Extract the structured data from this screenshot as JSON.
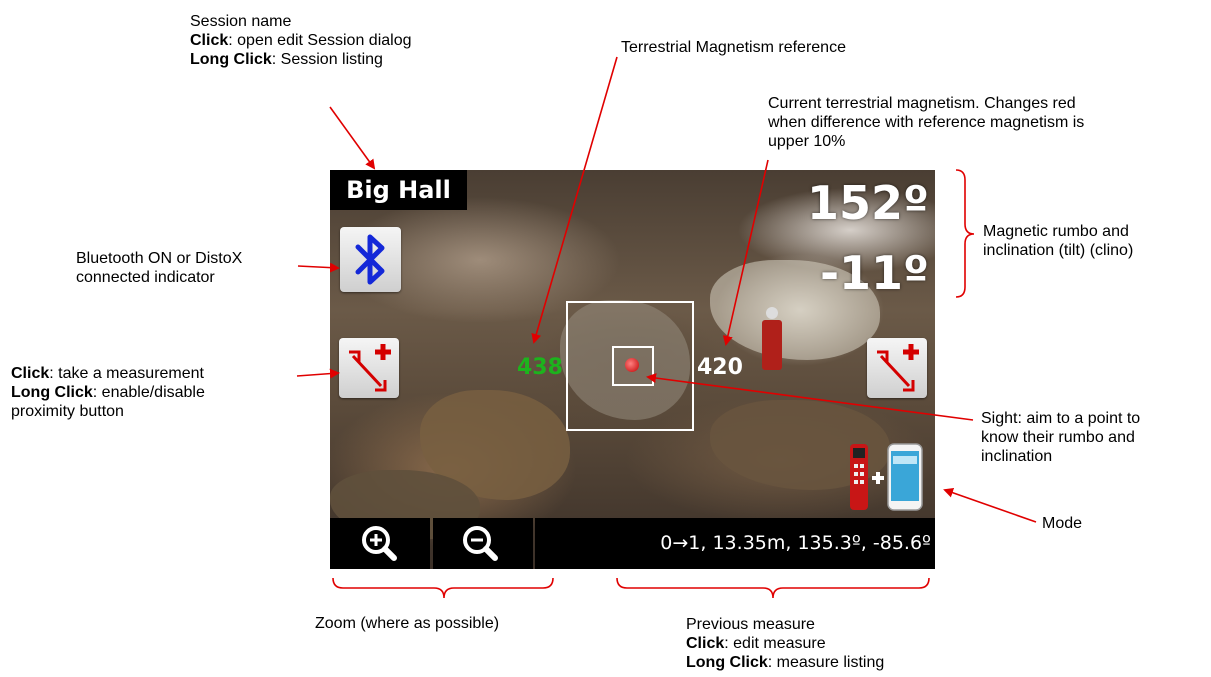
{
  "screen": {
    "session_name": "Big Hall",
    "rumbo": "152º",
    "tilt": "-11º",
    "reference_magnetism": "438",
    "current_magnetism": "420",
    "previous_measure": "0→1, 13.35m, 135.3º, -85.6º",
    "icons": {
      "bluetooth": "bluetooth-icon",
      "measure_left": "measure-icon",
      "measure_right": "measure-icon",
      "zoom_in": "zoom-in-icon",
      "zoom_out": "zoom-out-icon",
      "mode": "distox-phone-mode-icon"
    },
    "colors": {
      "reference_magnetism": "#1db31d",
      "current_magnetism": "#ffffff",
      "annotation_arrow": "#e00000",
      "bluetooth": "#1428d8"
    }
  },
  "annotations": {
    "session": {
      "title": "Session name",
      "click_label": "Click",
      "click_text": ": open edit Session dialog",
      "long_label": "Long Click",
      "long_text": ": Session listing"
    },
    "terrestrial_ref": "Terrestrial Magnetism reference",
    "current_mag": {
      "line1": "Current terrestrial magnetism. Changes red",
      "line2": "when difference with reference  magnetism is",
      "line3": "upper 10%"
    },
    "rumbo_tilt": {
      "line1": "Magnetic rumbo and",
      "line2": "inclination (tilt) (clino)"
    },
    "bluetooth": {
      "line1": "Bluetooth ON or DistoX",
      "line2": "connected indicator"
    },
    "measure_btn": {
      "click_label": "Click",
      "click_text": ": take a measurement",
      "long_label": "Long Click",
      "long_text": ": enable/disable",
      "line3": "proximity button"
    },
    "sight": {
      "line1": "Sight: aim to a point to",
      "line2": "know their rumbo and",
      "line3": "inclination"
    },
    "mode": "Mode",
    "zoom": "Zoom (where as possible)",
    "previous": {
      "title": "Previous measure",
      "click_label": "Click",
      "click_text": ": edit measure",
      "long_label": "Long Click",
      "long_text": ": measure listing"
    }
  }
}
